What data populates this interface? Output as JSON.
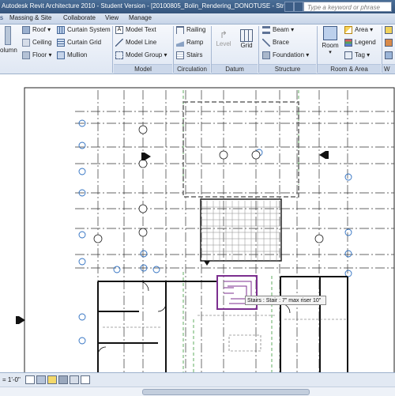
{
  "window": {
    "title": "Autodesk Revit Architecture 2010 - Student Version - [20100805_Bolin_Rendering_DONOTUSE - Structura...",
    "search_placeholder": "Type a keyword or phrase"
  },
  "menu": [
    "Massing & Site",
    "Collaborate",
    "View",
    "Manage"
  ],
  "ribbon": {
    "column_label": "olumn",
    "build_col1": [
      "Roof",
      "Ceiling",
      "Floor"
    ],
    "build_col2": [
      "Curtain System",
      "Curtain Grid",
      "Mullion"
    ],
    "model_items": [
      "Model Text",
      "Model Line",
      "Model Group"
    ],
    "circulation_items": [
      "Railing",
      "Ramp",
      "Stairs"
    ],
    "datum_level": "Level",
    "datum_grid": "Grid",
    "structure_items": [
      "Beam",
      "Brace",
      "Foundation"
    ],
    "room_label": "Room",
    "room_items": [
      "Area",
      "Legend",
      "Tag"
    ],
    "groups": {
      "model": "Model",
      "circulation": "Circulation",
      "datum": "Datum",
      "structure": "Structure",
      "room_area": "Room & Area",
      "w": "W"
    }
  },
  "canvas": {
    "tooltip": "Stairs : Stair : 7\" max riser 10\""
  },
  "status": {
    "scale": "= 1'-0\""
  },
  "colors": {
    "titlebar": "#3f6190",
    "ribbon_bg": "#e4ebf5",
    "stair_highlight": "#7c2f8f",
    "dashed_green": "#3a9a3a",
    "bubble_blue": "#2d6fc1"
  }
}
